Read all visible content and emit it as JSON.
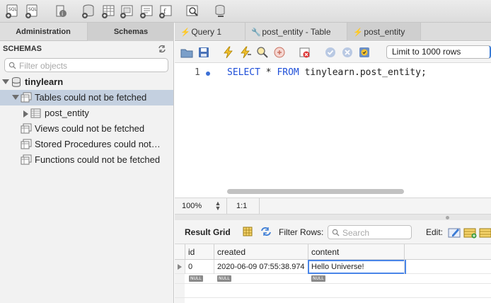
{
  "toolbar": {
    "buttons": [
      "new-sql-tab-icon",
      "open-sql-script-icon",
      "inspect-object-icon",
      "create-schema-icon",
      "create-table-icon",
      "create-view-icon",
      "create-procedure-icon",
      "create-function-icon",
      "search-table-data-icon",
      "reconnect-icon"
    ]
  },
  "left": {
    "tabs": {
      "administration": "Administration",
      "schemas": "Schemas"
    },
    "header": "SCHEMAS",
    "filter_placeholder": "Filter objects",
    "tree": {
      "schema": "tinylearn",
      "tables": "Tables could not be fetched",
      "table_item": "post_entity",
      "views": "Views could not be fetched",
      "procedures": "Stored Procedures could not…",
      "functions": "Functions could not be fetched"
    }
  },
  "tabs": {
    "query1": "Query 1",
    "post_entity_table": "post_entity - Table",
    "post_entity": "post_entity"
  },
  "editor_toolbar": {
    "limit": "Limit to 1000 rows"
  },
  "editor": {
    "line_number": "1",
    "sql": {
      "select": "SELECT",
      "star": " * ",
      "from": "FROM",
      "target": " tinylearn.post_entity;"
    }
  },
  "status": {
    "zoom": "100%",
    "cursor": "1:1"
  },
  "results": {
    "label": "Result Grid",
    "filter_label": "Filter Rows:",
    "search_placeholder": "Search",
    "edit_label": "Edit:",
    "columns": [
      "id",
      "created",
      "content"
    ],
    "row": {
      "id": "0",
      "created": "2020-06-09 07:55:38.974",
      "content": "Hello Universe!"
    },
    "null_label": "NULL"
  },
  "colors": {
    "accent": "#3a7bd5",
    "keyword": "#1f4fd8",
    "selection": "#c4d0e0"
  }
}
